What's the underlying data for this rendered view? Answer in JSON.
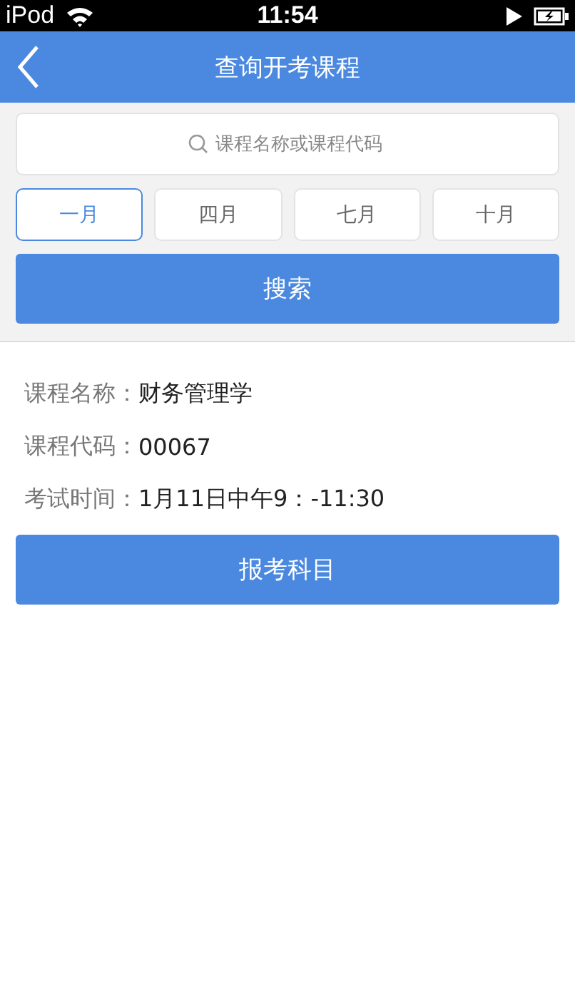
{
  "status_bar": {
    "carrier": "iPod",
    "time": "11:54"
  },
  "nav": {
    "title": "查询开考课程"
  },
  "search": {
    "placeholder": "课程名称或课程代码"
  },
  "months": [
    {
      "label": "一月",
      "selected": true
    },
    {
      "label": "四月",
      "selected": false
    },
    {
      "label": "七月",
      "selected": false
    },
    {
      "label": "十月",
      "selected": false
    }
  ],
  "search_button": "搜索",
  "course": [
    {
      "label": "课程名称：",
      "value": "财务管理学"
    },
    {
      "label": "课程代码：",
      "value": "00067"
    },
    {
      "label": "考试时间：",
      "value": "1月11日中午9：-11:30"
    }
  ],
  "register_button": "报考科目"
}
